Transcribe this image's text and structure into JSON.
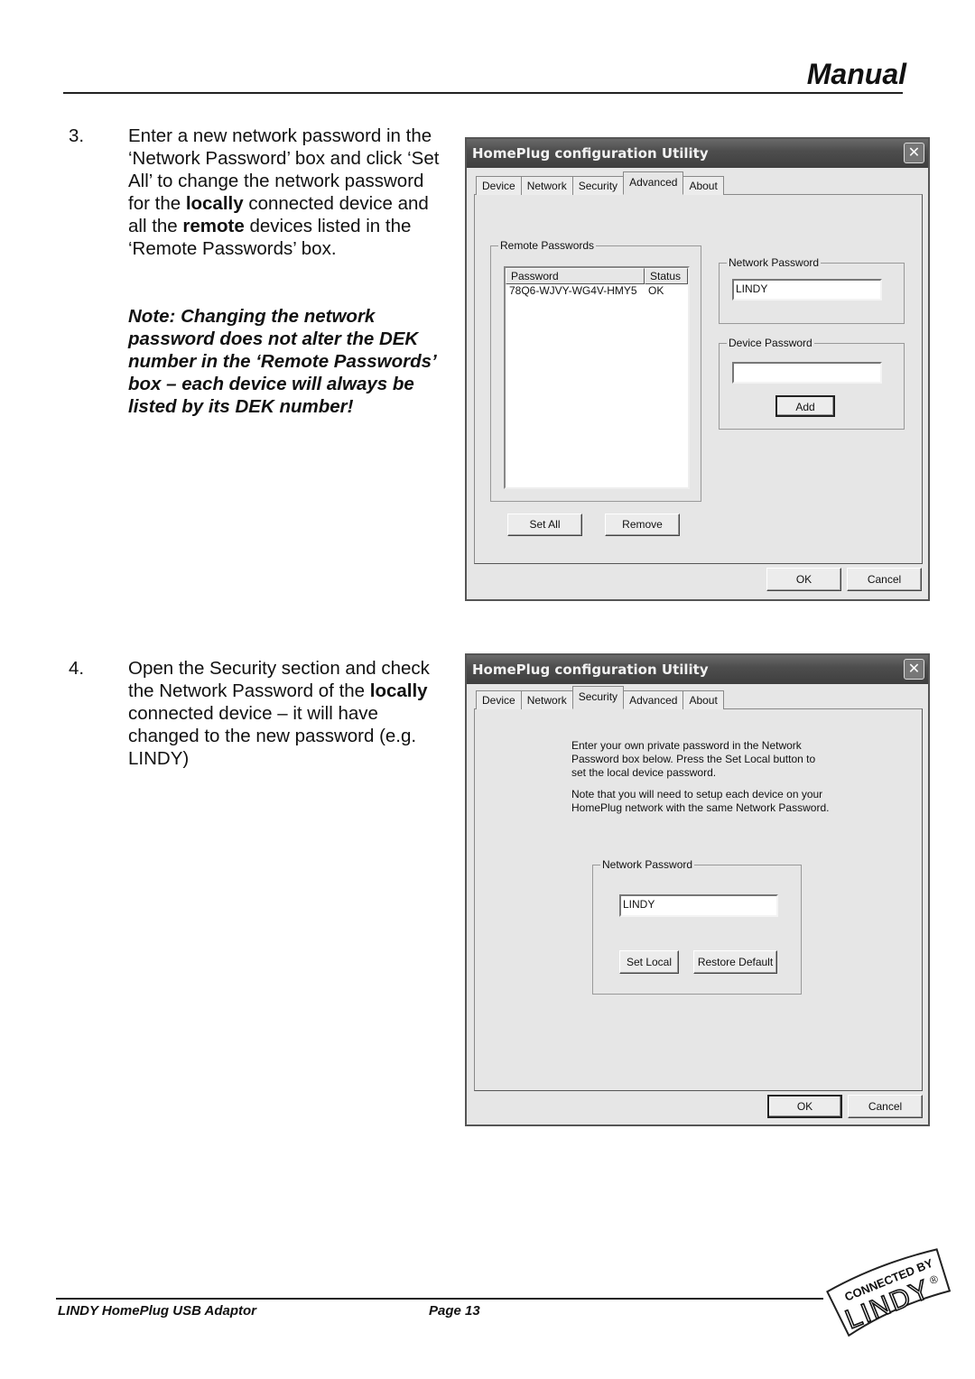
{
  "header": {
    "title": "Manual"
  },
  "step3": {
    "number": "3.",
    "text_parts": [
      "Enter a new network password in the ‘Network Password’ box and click ‘Set All’ to change the network password for the ",
      "locally",
      " connected device and all the ",
      "remote",
      " devices listed in the ‘Remote Passwords’ box."
    ],
    "note": "Note: Changing the network password does not alter the DEK number in the ‘Remote Passwords’ box – each device will always be listed by its DEK number!"
  },
  "step4": {
    "number": "4.",
    "text_parts": [
      "Open the Security section and check the Network Password of the ",
      "locally",
      " connected device – it will have changed to the new password (e.g. LINDY)"
    ]
  },
  "dialog_advanced": {
    "title": "HomePlug configuration Utility",
    "close_icon": "close-icon",
    "tabs": [
      "Device",
      "Network",
      "Security",
      "Advanced",
      "About"
    ],
    "active_tab": "Advanced",
    "remote_passwords": {
      "legend": "Remote Passwords",
      "columns": [
        "Password",
        "Status"
      ],
      "rows": [
        {
          "password": "78Q6-WJVY-WG4V-HMY5",
          "status": "OK"
        }
      ]
    },
    "network_password": {
      "legend": "Network Password",
      "value": "LINDY"
    },
    "device_password": {
      "legend": "Device Password",
      "value": "",
      "add_label": "Add"
    },
    "set_all_label": "Set All",
    "remove_label": "Remove",
    "ok_label": "OK",
    "cancel_label": "Cancel"
  },
  "dialog_security": {
    "title": "HomePlug configuration Utility",
    "close_icon": "close-icon",
    "tabs": [
      "Device",
      "Network",
      "Security",
      "Advanced",
      "About"
    ],
    "active_tab": "Security",
    "info_lines_1": [
      "Enter your own private password in the Network",
      "Password box below. Press the Set Local button to",
      "set the local device password."
    ],
    "info_lines_2": [
      "Note that you will need to setup each device on your",
      "HomePlug network with the same Network Password."
    ],
    "network_password": {
      "legend": "Network Password",
      "value": "LINDY"
    },
    "set_local_label": "Set Local",
    "restore_default_label": "Restore Default",
    "ok_label": "OK",
    "cancel_label": "Cancel"
  },
  "footer": {
    "product": "LINDY HomePlug USB Adaptor",
    "page": "Page 13",
    "logo_top": "CONNECTED BY",
    "logo_main": "LINDY",
    "logo_mark": "®"
  }
}
